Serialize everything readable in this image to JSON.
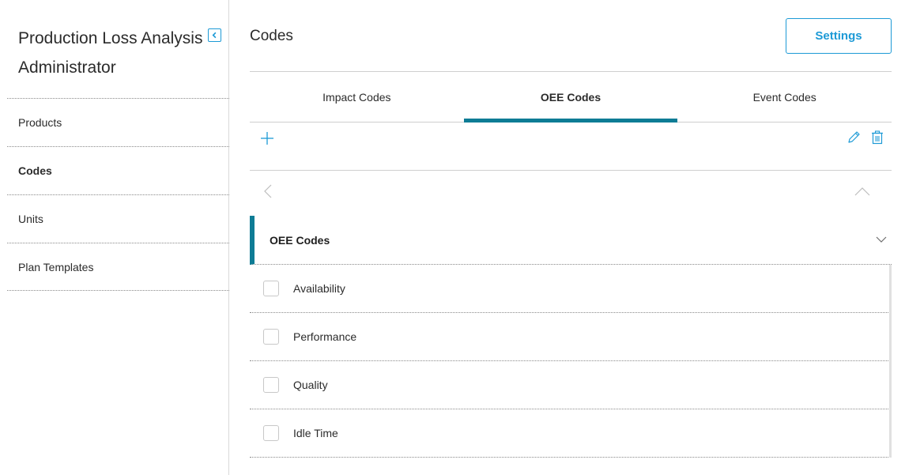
{
  "sidebar": {
    "title": "Production Loss Analysis Administrator",
    "collapse_icon": "chevron-left-icon",
    "items": [
      {
        "label": "Products",
        "active": false
      },
      {
        "label": "Codes",
        "active": true
      },
      {
        "label": "Units",
        "active": false
      },
      {
        "label": "Plan Templates",
        "active": false
      }
    ]
  },
  "header": {
    "title": "Codes",
    "settings_label": "Settings"
  },
  "tabs": [
    {
      "label": "Impact Codes",
      "active": false
    },
    {
      "label": "OEE Codes",
      "active": true
    },
    {
      "label": "Event Codes",
      "active": false
    }
  ],
  "toolbar": {
    "add_icon": "plus-icon",
    "edit_icon": "pencil-icon",
    "delete_icon": "trash-icon"
  },
  "group": {
    "title": "OEE Codes",
    "items": [
      {
        "label": "Availability",
        "checked": false
      },
      {
        "label": "Performance",
        "checked": false
      },
      {
        "label": "Quality",
        "checked": false
      },
      {
        "label": "Idle Time",
        "checked": false
      }
    ]
  },
  "colors": {
    "accent": "#1d9ad6",
    "active_tab": "#0e7c95"
  }
}
